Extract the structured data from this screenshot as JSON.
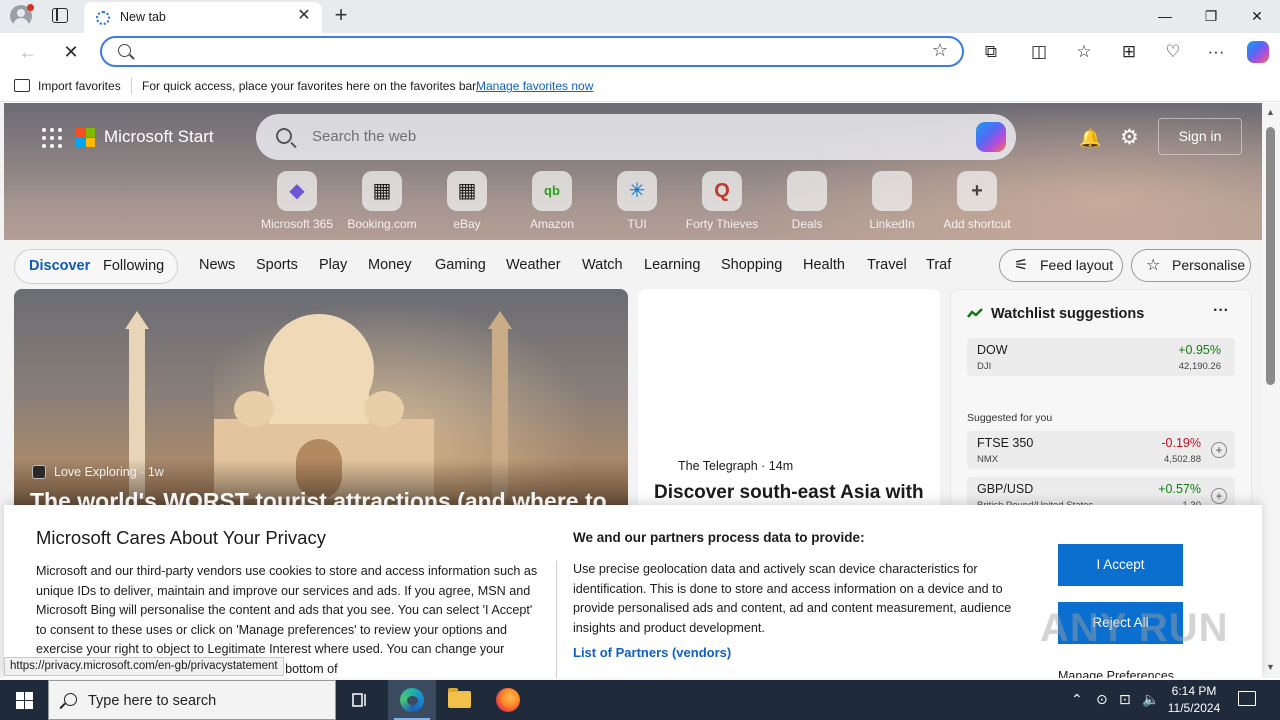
{
  "browser": {
    "tab": {
      "title": "New tab",
      "close": "✕"
    },
    "new_tab": "+",
    "window": {
      "minimize": "—",
      "restore": "❐",
      "close": "✕"
    },
    "toolbar": {
      "back": "←",
      "reload": "✕",
      "address_value": "",
      "star": "☆"
    },
    "icons": {
      "extensions": "⧉",
      "split": "◫",
      "favorites": "☆",
      "collections": "⊞",
      "performance": "♡",
      "more": "···"
    },
    "favorites_bar": {
      "import": "Import favorites",
      "hint": "For quick access, place your favorites here on the favorites bar.",
      "manage_link": "Manage favorites now"
    }
  },
  "ntp": {
    "brand": "Microsoft Start",
    "search_placeholder": "Search the web",
    "sign_in": "Sign in",
    "bell": "🔔",
    "gear": "⚙",
    "shortcuts": [
      {
        "label": "Microsoft 365",
        "glyph": "◆",
        "color": "#6b57d6"
      },
      {
        "label": "Booking.com",
        "glyph": "▦",
        "color": "#1f1f1f"
      },
      {
        "label": "eBay",
        "glyph": "▦",
        "color": "#1f1f1f"
      },
      {
        "label": "Amazon",
        "glyph": "qb",
        "color": "#2ca01c"
      },
      {
        "label": "TUI",
        "glyph": "✳",
        "color": "#0071ce"
      },
      {
        "label": "Forty Thieves",
        "glyph": "Q",
        "color": "#c0392b"
      },
      {
        "label": "Deals",
        "glyph": "",
        "color": "#ffffff"
      },
      {
        "label": "LinkedIn",
        "glyph": "",
        "color": "#ffffff"
      },
      {
        "label": "Add shortcut",
        "glyph": "+",
        "color": "#444444"
      }
    ],
    "feed_tabs": {
      "discover": "Discover",
      "following": "Following"
    },
    "categories": [
      "News",
      "Sports",
      "Play",
      "Money",
      "Gaming",
      "Weather",
      "Watch",
      "Learning",
      "Shopping",
      "Health",
      "Travel",
      "Traf"
    ],
    "feed_layout": "Feed layout",
    "personalise": "Personalise",
    "hero_card": {
      "source": "Love Exploring",
      "age": "1w",
      "title": "The world's WORST tourist attractions (and where to"
    },
    "card2": {
      "source": "The Telegraph",
      "age": "14m",
      "title": "Discover south-east Asia with"
    },
    "watchlist": {
      "title": "Watchlist suggestions",
      "more": "···",
      "suggested_label": "Suggested for you",
      "stocks": [
        {
          "symbol": "DOW",
          "sub": "DJI",
          "change": "+0.95%",
          "price": "42,190.26",
          "color": "#107c10",
          "plus": false
        },
        {
          "symbol": "FTSE 350",
          "sub": "NMX",
          "change": "-0.19%",
          "price": "4,502.88",
          "color": "#c50f1f",
          "plus": true
        },
        {
          "symbol": "GBP/USD",
          "sub": "British Pound/United States",
          "change": "+0.57%",
          "price": "1.30",
          "color": "#107c10",
          "plus": true
        }
      ]
    }
  },
  "privacy": {
    "title": "Microsoft Cares About Your Privacy",
    "body": "Microsoft and our third-party vendors use cookies to store and access information such as unique IDs to deliver, maintain and improve our services and ads. If you agree, MSN and Microsoft Bing will personalise the content and ads that you see. You can select 'I Accept' to consent to these uses or click on 'Manage preferences' to review your options and exercise your right to object to Legitimate Interest where used. You can change your selection under 'Manage Preferences' at the bottom of",
    "partners_heading": "We and our partners process data to provide:",
    "partners_body": "Use precise geolocation data and actively scan device characteristics for identification. This is done to store and access information on a device and to provide personalised ads and content, ad and content measurement, audience insights and product development.",
    "partners_link": "List of Partners (vendors)",
    "accept": "I Accept",
    "reject": "Reject All",
    "manage": "Manage Preferences",
    "watermark": "ANY RUN"
  },
  "status_url": "https://privacy.microsoft.com/en-gb/privacystatement",
  "taskbar": {
    "search_placeholder": "Type here to search",
    "time": "6:14 PM",
    "date": "11/5/2024",
    "tray_chevron": "⌃",
    "tray_icons": [
      "⊙",
      "⊡",
      "🔈"
    ]
  }
}
